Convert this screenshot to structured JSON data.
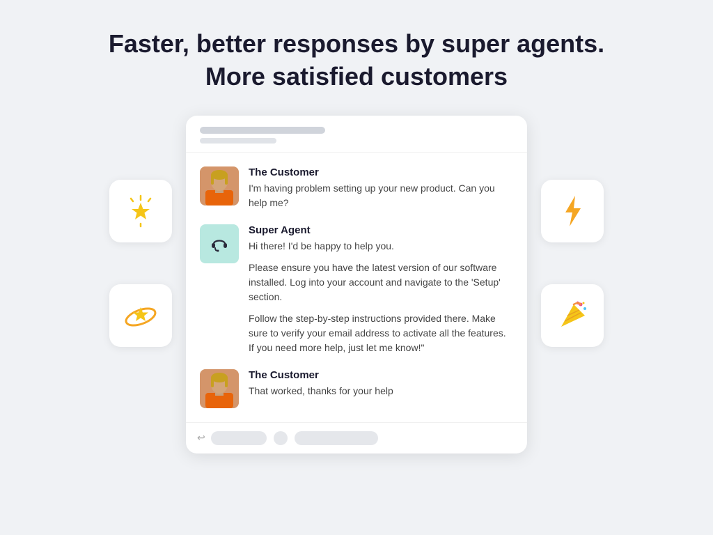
{
  "headline": {
    "line1": "Faster, better responses by super agents.",
    "line2": "More satisfied customers"
  },
  "icons": {
    "left_top": "⭐",
    "left_bottom": "🌟",
    "right_top": "⚡",
    "right_bottom": "🎉"
  },
  "chat": {
    "header_bar_label": "header bar",
    "messages": [
      {
        "sender": "The Customer",
        "role": "customer",
        "text_paragraphs": [
          "I'm having problem setting up your new product. Can you help me?"
        ]
      },
      {
        "sender": "Super Agent",
        "role": "agent",
        "text_paragraphs": [
          "Hi there! I'd be happy to help you.",
          "Please ensure you have the latest version of our software installed. Log into your account and navigate to the 'Setup' section.",
          "Follow the step-by-step instructions provided there. Make sure to verify your email address to activate all the features. If you need more help, just let me know!\""
        ]
      },
      {
        "sender": "The Customer",
        "role": "customer",
        "text_paragraphs": [
          "That worked, thanks for your help"
        ]
      }
    ]
  }
}
